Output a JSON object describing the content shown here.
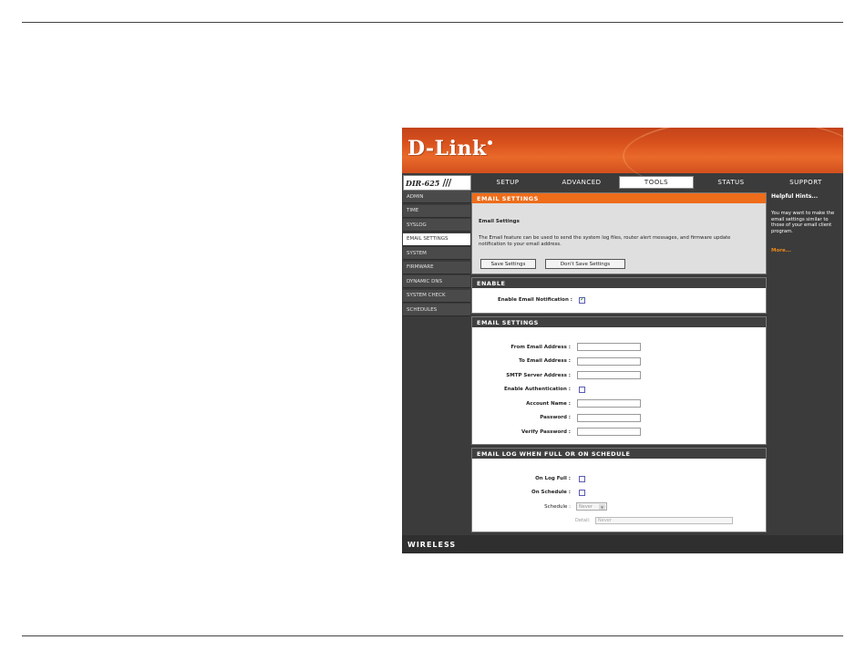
{
  "brand": {
    "logo": "D-Link",
    "model": "DIR-625",
    "footer": "WIRELESS"
  },
  "tabs": [
    {
      "label": "SETUP",
      "active": false
    },
    {
      "label": "ADVANCED",
      "active": false
    },
    {
      "label": "TOOLS",
      "active": true
    },
    {
      "label": "STATUS",
      "active": false
    },
    {
      "label": "SUPPORT",
      "active": false
    }
  ],
  "menu": [
    {
      "label": "ADMIN",
      "active": false
    },
    {
      "label": "TIME",
      "active": false
    },
    {
      "label": "SYSLOG",
      "active": false
    },
    {
      "label": "EMAIL SETTINGS",
      "active": true
    },
    {
      "label": "SYSTEM",
      "active": false
    },
    {
      "label": "FIRMWARE",
      "active": false
    },
    {
      "label": "DYNAMIC DNS",
      "active": false
    },
    {
      "label": "SYSTEM CHECK",
      "active": false
    },
    {
      "label": "SCHEDULES",
      "active": false
    }
  ],
  "intro": {
    "header": "EMAIL SETTINGS",
    "title": "Email Settings",
    "text": "The Email feature can be used to send the system log files, router alert messages, and firmware update notification to your email address.",
    "save_button": "Save Settings",
    "dont_save_button": "Don't Save Settings"
  },
  "enable": {
    "header": "ENABLE",
    "notification_label": "Enable Email Notification :",
    "notification_checked": true,
    "check_glyph": "✓"
  },
  "email": {
    "header": "EMAIL SETTINGS",
    "from_label": "From Email Address :",
    "from_value": "",
    "to_label": "To Email Address :",
    "to_value": "",
    "smtp_label": "SMTP Server Address :",
    "smtp_value": "",
    "auth_label": "Enable Authentication :",
    "auth_checked": false,
    "account_label": "Account Name :",
    "account_value": "",
    "password_label": "Password :",
    "password_value": "",
    "verify_label": "Verify Password :",
    "verify_value": ""
  },
  "log": {
    "header": "EMAIL LOG WHEN FULL OR ON SCHEDULE",
    "full_label": "On Log Full :",
    "full_checked": false,
    "schedule_label": "On Schedule :",
    "schedule_checked": false,
    "schedule_select_label": "Schedule :",
    "schedule_value": "Never",
    "detail_label": "Detail:",
    "detail_value": "Never"
  },
  "hints": {
    "title": "Helpful Hints...",
    "text": "You may want to make the email settings similar to those of your email client program.",
    "more": "More..."
  }
}
